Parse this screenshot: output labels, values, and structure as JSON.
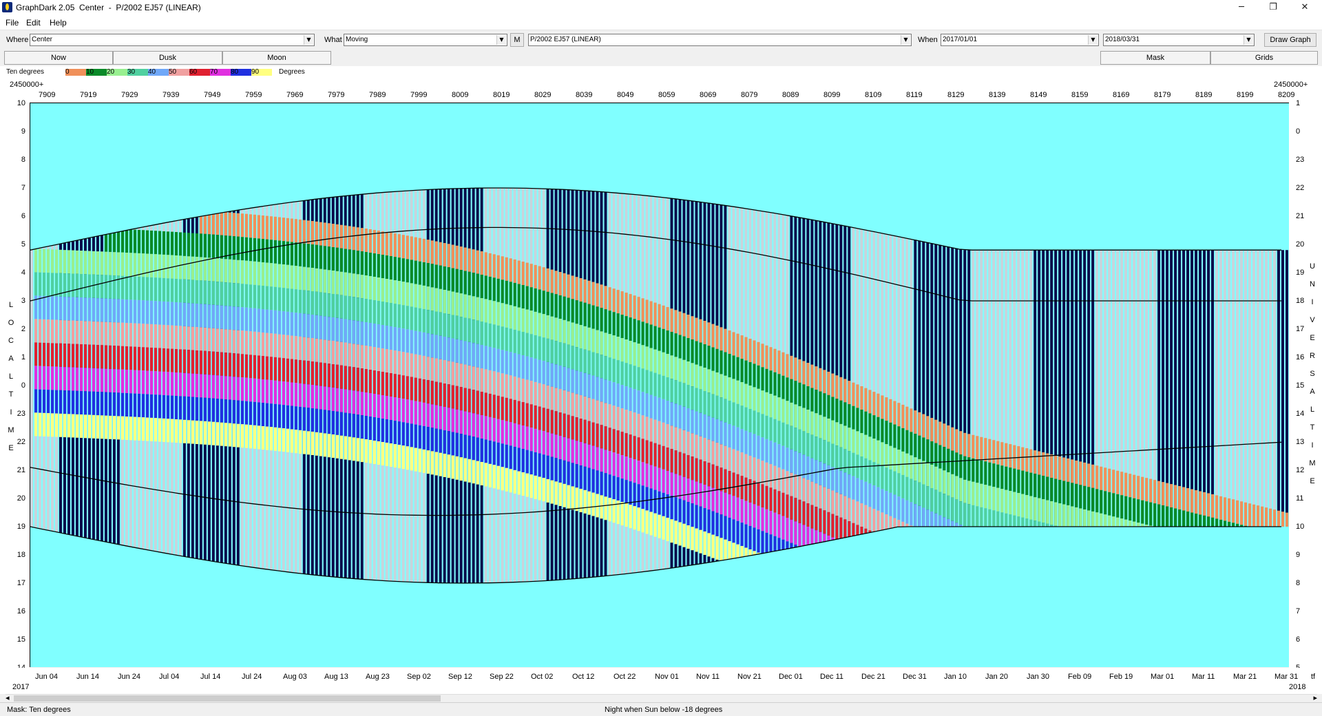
{
  "window": {
    "title": "GraphDark 2.05  Center  -  P/2002 EJ57 (LINEAR)",
    "minimize_glyph": "─",
    "restore_glyph": "❐",
    "close_glyph": "✕"
  },
  "menu": [
    "File",
    "Edit",
    "Help"
  ],
  "toolbar": {
    "where_label": "Where",
    "where_value": "Center",
    "what_label": "What",
    "what_value": "Moving",
    "m_button": "M",
    "object_value": "P/2002 EJ57 (LINEAR)",
    "when_label": "When",
    "when_start": "2017/01/01",
    "when_end": "2018/03/31",
    "draw_button": "Draw Graph"
  },
  "tabs": {
    "now": "Now",
    "dusk": "Dusk",
    "moon": "Moon",
    "mask": "Mask",
    "grids": "Grids"
  },
  "legend": {
    "left_label": "Ten degrees",
    "right_label": "Degrees",
    "stops": [
      {
        "label": "0",
        "color": "#f0905a"
      },
      {
        "label": "10",
        "color": "#0a8a28"
      },
      {
        "label": "20",
        "color": "#98f090"
      },
      {
        "label": "30",
        "color": "#50d0a0"
      },
      {
        "label": "40",
        "color": "#70a8f8"
      },
      {
        "label": "50",
        "color": "#f0a0a0"
      },
      {
        "label": "60",
        "color": "#e02030"
      },
      {
        "label": "70",
        "color": "#e030e0"
      },
      {
        "label": "80",
        "color": "#2030e0"
      },
      {
        "label": "90",
        "color": "#ffff80"
      }
    ]
  },
  "top_axis": {
    "left_prefix": "2450000+",
    "right_prefix": "2450000+",
    "ticks": [
      "7909",
      "7919",
      "7929",
      "7939",
      "7949",
      "7959",
      "7969",
      "7979",
      "7989",
      "7999",
      "8009",
      "8019",
      "8029",
      "8039",
      "8049",
      "8059",
      "8069",
      "8079",
      "8089",
      "8099",
      "8109",
      "8119",
      "8129",
      "8139",
      "8149",
      "8159",
      "8169",
      "8179",
      "8189",
      "8199",
      "8209"
    ]
  },
  "left_axis": {
    "title": "LOCAL TIME",
    "ticks": [
      "10",
      "9",
      "8",
      "7",
      "6",
      "5",
      "4",
      "3",
      "2",
      "1",
      "0",
      "23",
      "22",
      "21",
      "20",
      "19",
      "18",
      "17",
      "16",
      "15",
      "14"
    ]
  },
  "right_axis": {
    "title": "UNIVERSAL TIME",
    "ticks": [
      "1",
      "0",
      "23",
      "22",
      "21",
      "20",
      "19",
      "18",
      "17",
      "16",
      "15",
      "14",
      "13",
      "12",
      "11",
      "10",
      "9",
      "8",
      "7",
      "6",
      "5"
    ]
  },
  "bottom_axis": {
    "left_year": "2017",
    "right_year": "2018",
    "right_suffix": "tf",
    "ticks": [
      "Jun 04",
      "Jun 14",
      "Jun 24",
      "Jul 04",
      "Jul 14",
      "Jul 24",
      "Aug 03",
      "Aug 13",
      "Aug 23",
      "Sep 02",
      "Sep 12",
      "Sep 22",
      "Oct 02",
      "Oct 12",
      "Oct 22",
      "Nov 01",
      "Nov 11",
      "Nov 21",
      "Dec 01",
      "Dec 11",
      "Dec 21",
      "Dec 31",
      "Jan 10",
      "Jan 20",
      "Jan 30",
      "Feb 09",
      "Feb 19",
      "Mar 01",
      "Mar 11",
      "Mar 21",
      "Mar 31"
    ]
  },
  "scrollbar": {
    "left_arrow": "◂",
    "right_arrow": "▸"
  },
  "status": {
    "mask": "Mask:  Ten degrees",
    "night": "Night when Sun below -18 degrees"
  },
  "colors": {
    "sky": "#80ffff",
    "night": "#0a0a4a",
    "moonlit": "#c8d4dc",
    "moon_deep": "#1480c0"
  }
}
